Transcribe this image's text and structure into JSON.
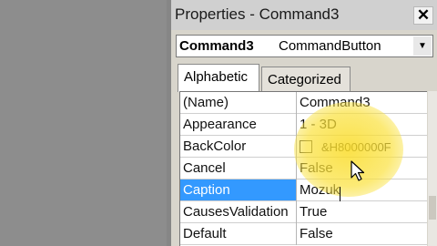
{
  "window": {
    "title": "Properties - Command3"
  },
  "object_selector": {
    "name": "Command3",
    "type": "CommandButton"
  },
  "tabs": [
    {
      "label": "Alphabetic",
      "active": true
    },
    {
      "label": "Categorized",
      "active": false
    }
  ],
  "properties": [
    {
      "name": "(Name)",
      "value": "Command3"
    },
    {
      "name": "Appearance",
      "value": "1 - 3D"
    },
    {
      "name": "BackColor",
      "value": "&H8000000F"
    },
    {
      "name": "Cancel",
      "value": "False"
    },
    {
      "name": "Caption",
      "value": "Mozuk",
      "selected": true
    },
    {
      "name": "CausesValidation",
      "value": "True"
    },
    {
      "name": "Default",
      "value": "False"
    }
  ],
  "colors": {
    "selection": "#3399ff",
    "highlight": "#f9d92a"
  },
  "icons": {
    "close": "close-icon",
    "dropdown": "chevron-down-icon",
    "cursor": "mouse-pointer-icon"
  }
}
